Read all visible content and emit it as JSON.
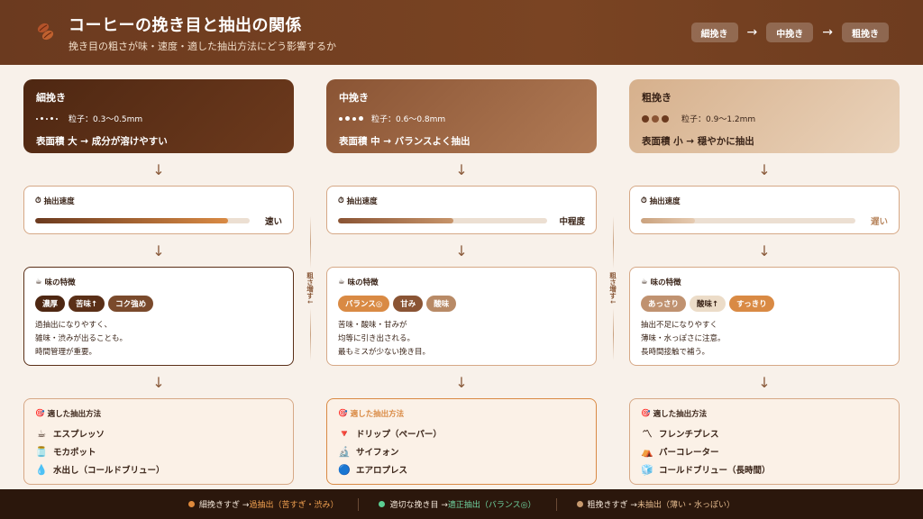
{
  "header": {
    "title": "コーヒーの挽き目と抽出の関係",
    "subtitle": "挽き目の粗さが味・速度・適した抽出方法にどう影響するか",
    "steps": [
      "細挽き",
      "中挽き",
      "粗挽き"
    ],
    "step_arrow": "→"
  },
  "arrow_glyph": "↓",
  "side_label": "粗さ増す↓",
  "columns": {
    "fine": {
      "name": "細挽き",
      "particle": "粒子：0.3〜0.5mm",
      "surface": "表面積 大 → 成分が溶けやすい",
      "speed_header": "抽出速度",
      "speed_fill": 0.9,
      "speed_label": "速い",
      "taste_header": "味の特徴",
      "chips": [
        "濃厚",
        "苦味↑",
        "コク強め"
      ],
      "desc": [
        "過抽出になりやすく、",
        "雑味・渋みが出ることも。",
        "時間管理が重要。"
      ],
      "method_header": "適した抽出方法",
      "methods": [
        {
          "icon": "coffee-cup-icon",
          "glyph": "☕",
          "label": "エスプレッソ"
        },
        {
          "icon": "moka-pot-icon",
          "glyph": "🫙",
          "label": "モカポット"
        },
        {
          "icon": "water-drop-icon",
          "glyph": "💧",
          "label": "水出し（コールドブリュー）"
        }
      ]
    },
    "medium": {
      "name": "中挽き",
      "particle": "粒子：0.6〜0.8mm",
      "surface": "表面積 中 → バランスよく抽出",
      "speed_header": "抽出速度",
      "speed_fill": 0.55,
      "speed_label": "中程度",
      "taste_header": "味の特徴",
      "chips": [
        "バランス◎",
        "甘み",
        "酸味"
      ],
      "desc": [
        "苦味・酸味・甘みが",
        "均等に引き出される。",
        "最もミスが少ない挽き目。"
      ],
      "method_header": "適した抽出方法",
      "methods": [
        {
          "icon": "drip-icon",
          "glyph": "🔻",
          "label": "ドリップ（ペーパー）"
        },
        {
          "icon": "siphon-icon",
          "glyph": "🔬",
          "label": "サイフォン"
        },
        {
          "icon": "aeropress-icon",
          "glyph": "🔵",
          "label": "エアロプレス"
        }
      ]
    },
    "coarse": {
      "name": "粗挽き",
      "particle": "粒子：0.9〜1.2mm",
      "surface": "表面積 小 → 穏やかに抽出",
      "speed_header": "抽出速度",
      "speed_fill": 0.25,
      "speed_label": "遅い",
      "taste_header": "味の特徴",
      "chips": [
        "あっさり",
        "酸味↑",
        "すっきり"
      ],
      "desc": [
        "抽出不足になりやすく",
        "薄味・水っぽさに注意。",
        "長時間接触で補う。"
      ],
      "method_header": "適した抽出方法",
      "methods": [
        {
          "icon": "french-press-icon",
          "glyph": "〽",
          "label": "フレンチプレス"
        },
        {
          "icon": "percolator-icon",
          "glyph": "⛺",
          "label": "パーコレーター"
        },
        {
          "icon": "ice-cube-icon",
          "glyph": "🧊",
          "label": "コールドブリュー（長時間）"
        }
      ]
    }
  },
  "footer": [
    {
      "lead": "細挽きすぎ → ",
      "hl": "過抽出（苦すぎ・渋み）",
      "color": "#e08a3c"
    },
    {
      "lead": "適切な挽き目 → ",
      "hl": "適正抽出（バランス◎）",
      "color": "#5ccf93"
    },
    {
      "lead": "粗挽きすぎ → ",
      "hl": "未抽出（薄い・水っぽい）",
      "color": "#c89a6e"
    }
  ],
  "colors": {
    "header_bg": "#6b3a1f",
    "accent_orange": "#d98a44",
    "dark_brown": "#4e2712",
    "footer_bg": "#2b170c"
  }
}
